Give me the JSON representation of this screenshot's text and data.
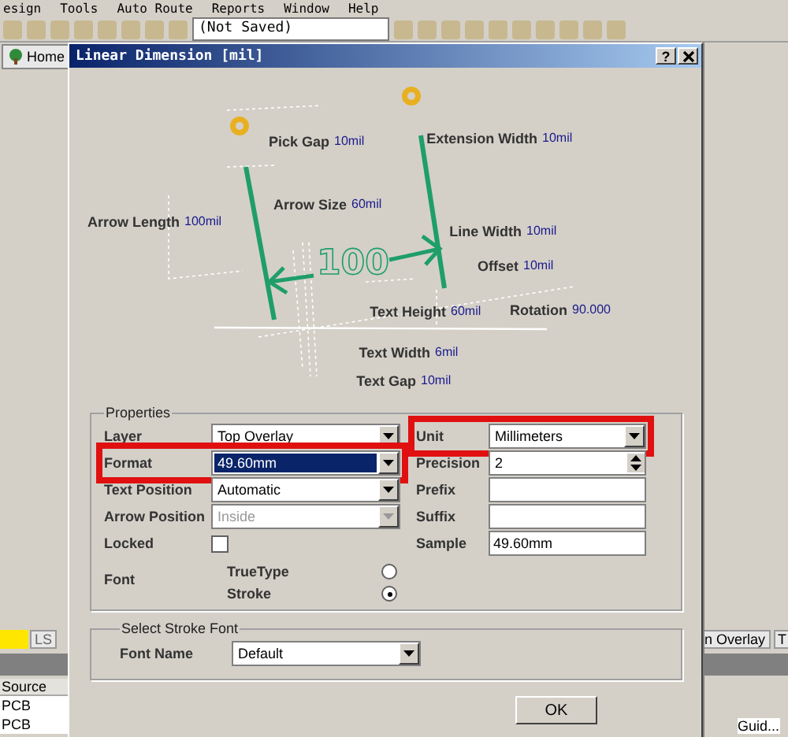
{
  "app": {
    "menu": [
      "esign",
      "Tools",
      "Auto Route",
      "Reports",
      "Window",
      "Help"
    ],
    "document_field": "(Not Saved)",
    "home_tab": "Home",
    "layer_tab": "LS",
    "right_layer_tab": "n Overlay",
    "right_tab_2": "T",
    "panel_column": "Source",
    "panel_rows": [
      "PCB",
      "PCB"
    ],
    "right_cell": "Guid..."
  },
  "dialog": {
    "title": "Linear Dimension [mil]",
    "help_button": "?",
    "diagram": {
      "sample_text": "100",
      "labels": [
        {
          "label": "Pick Gap",
          "value": "10mil"
        },
        {
          "label": "Extension Width",
          "value": "10mil"
        },
        {
          "label": "Arrow Size",
          "value": "60mil"
        },
        {
          "label": "Arrow Length",
          "value": "100mil"
        },
        {
          "label": "Line Width",
          "value": "10mil"
        },
        {
          "label": "Offset",
          "value": "10mil"
        },
        {
          "label": "Text Height",
          "value": "60mil"
        },
        {
          "label": "Rotation",
          "value": "90.000"
        },
        {
          "label": "Text Width",
          "value": "6mil"
        },
        {
          "label": "Text Gap",
          "value": "10mil"
        }
      ]
    },
    "properties": {
      "title": "Properties",
      "left": [
        {
          "kind": "dropdown",
          "label": "Layer",
          "value": "Top Overlay",
          "focused": false,
          "disabled": false,
          "highlighted": false
        },
        {
          "kind": "dropdown",
          "label": "Format",
          "value": "49.60mm",
          "focused": true,
          "disabled": false,
          "highlighted": true
        },
        {
          "kind": "dropdown",
          "label": "Text Position",
          "value": "Automatic",
          "focused": false,
          "disabled": false,
          "highlighted": false
        },
        {
          "kind": "dropdown",
          "label": "Arrow Position",
          "value": "Inside",
          "focused": false,
          "disabled": true,
          "highlighted": false
        },
        {
          "kind": "checkbox",
          "label": "Locked",
          "checked": false
        },
        {
          "kind": "radio",
          "label": "Font",
          "options": [
            {
              "label": "TrueType",
              "selected": false
            },
            {
              "label": "Stroke",
              "selected": true
            }
          ]
        }
      ],
      "right": [
        {
          "kind": "dropdown",
          "label": "Unit",
          "value": "Millimeters",
          "focused": false,
          "disabled": false,
          "highlighted": true
        },
        {
          "kind": "spin",
          "label": "Precision",
          "value": "2"
        },
        {
          "kind": "text",
          "label": "Prefix"
        },
        {
          "kind": "text",
          "label": "Suffix"
        },
        {
          "kind": "text",
          "label": "Sample",
          "value": "49.60mm"
        }
      ]
    },
    "stroke_font": {
      "title": "Select Stroke Font",
      "label": "Font Name",
      "value": "Default"
    },
    "buttons": [
      "OK"
    ]
  }
}
